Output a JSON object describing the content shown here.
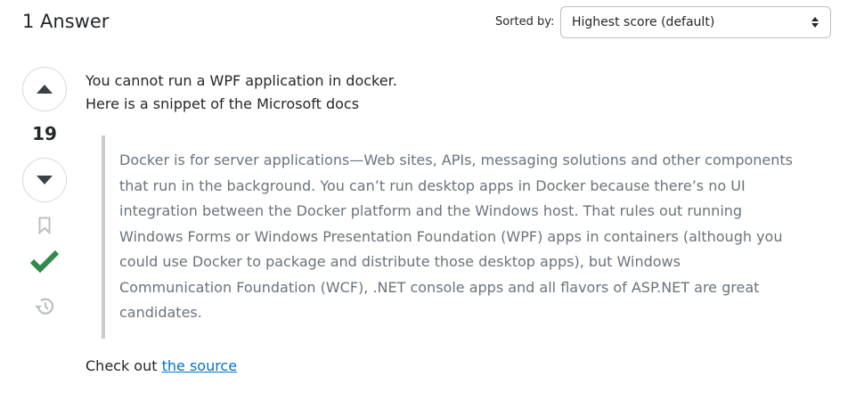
{
  "header": {
    "title": "1 Answer",
    "sorted_label": "Sorted by:",
    "sort_value": "Highest score (default)"
  },
  "answer": {
    "score": "19",
    "line1": "You cannot run a WPF application in docker.",
    "line2": "Here is a snippet of the Microsoft docs",
    "quote": "Docker is for server applications—Web sites, APIs, messaging solutions and other components that run in the background. You can’t run desktop apps in Docker because there’s no UI integration between the Docker platform and the Windows host. That rules out running Windows Forms or Windows Presentation Foundation (WPF) apps in containers (although you could use Docker to package and distribute those desktop apps), but Windows Communication Foundation (WCF), .NET console apps and all flavors of ASP.NET are great candidates.",
    "footer_prefix": "Check out ",
    "footer_link": "the source"
  },
  "colors": {
    "accepted": "#2f8a4c",
    "link": "#0074cc"
  }
}
